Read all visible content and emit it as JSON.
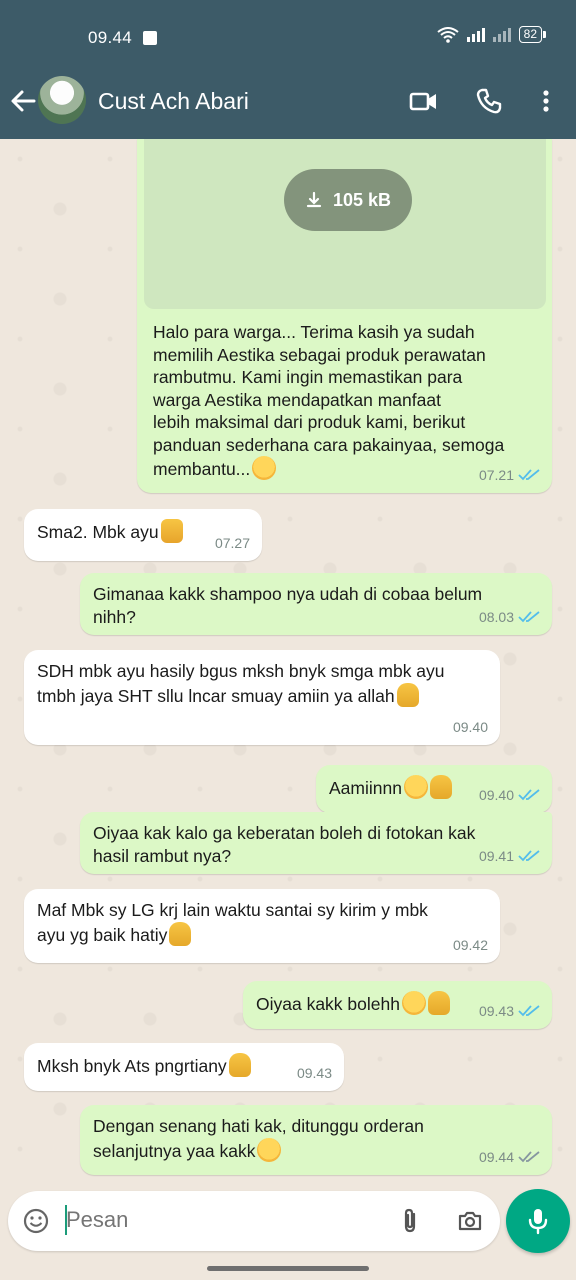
{
  "status_bar": {
    "time": "09.44",
    "battery": "82"
  },
  "header": {
    "contact_name": "Cust Ach Abari"
  },
  "media": {
    "size": "105 kB"
  },
  "messages": [
    {
      "dir": "out",
      "lines": [
        "Halo para warga... Terima kasih ya sudah",
        "memilih Aestika sebagai produk perawatan",
        "rambutmu. Kami ingin memastikan para",
        "warga Aestika mendapatkan manfaat",
        "lebih maksimal dari produk kami, berikut",
        "panduan sederhana cara pakainyaa, semoga",
        "membantu..."
      ],
      "time": "07.21",
      "status": "read"
    },
    {
      "dir": "in",
      "lines": [
        "Sma2. Mbk ayu"
      ],
      "time": "07.27"
    },
    {
      "dir": "out",
      "lines": [
        "Gimanaa kakk shampoo nya udah di cobaa belum",
        "nihh?"
      ],
      "time": "08.03",
      "status": "read"
    },
    {
      "dir": "in",
      "lines": [
        "SDH mbk ayu hasily bgus mksh bnyk smga mbk ayu",
        "tmbh  jaya SHT sllu lncar smuay amiin ya allah"
      ],
      "time": "09.40"
    },
    {
      "dir": "out",
      "lines": [
        "Aamiinnn"
      ],
      "time": "09.40",
      "status": "read"
    },
    {
      "dir": "out",
      "lines": [
        "Oiyaa kak kalo ga keberatan boleh di fotokan kak",
        "hasil rambut nya?"
      ],
      "time": "09.41",
      "status": "read"
    },
    {
      "dir": "in",
      "lines": [
        "Maf  Mbk sy LG krj  lain waktu santai sy  kirim y mbk",
        "ayu yg baik hatiy"
      ],
      "time": "09.42"
    },
    {
      "dir": "out",
      "lines": [
        "Oiyaa kakk bolehh"
      ],
      "time": "09.43",
      "status": "read"
    },
    {
      "dir": "in",
      "lines": [
        "Mksh bnyk Ats pngrtiany"
      ],
      "time": "09.43"
    },
    {
      "dir": "out",
      "lines": [
        "Dengan senang hati kak, ditunggu orderan",
        "selanjutnya yaa kakk"
      ],
      "time": "09.44",
      "status": "delivered"
    }
  ],
  "composer": {
    "placeholder": "Pesan"
  },
  "colors": {
    "header": "#3d5b68",
    "outgoing": "#dcf8c6",
    "incoming": "#ffffff",
    "read_tick": "#53bdeb",
    "mic": "#00a884"
  }
}
